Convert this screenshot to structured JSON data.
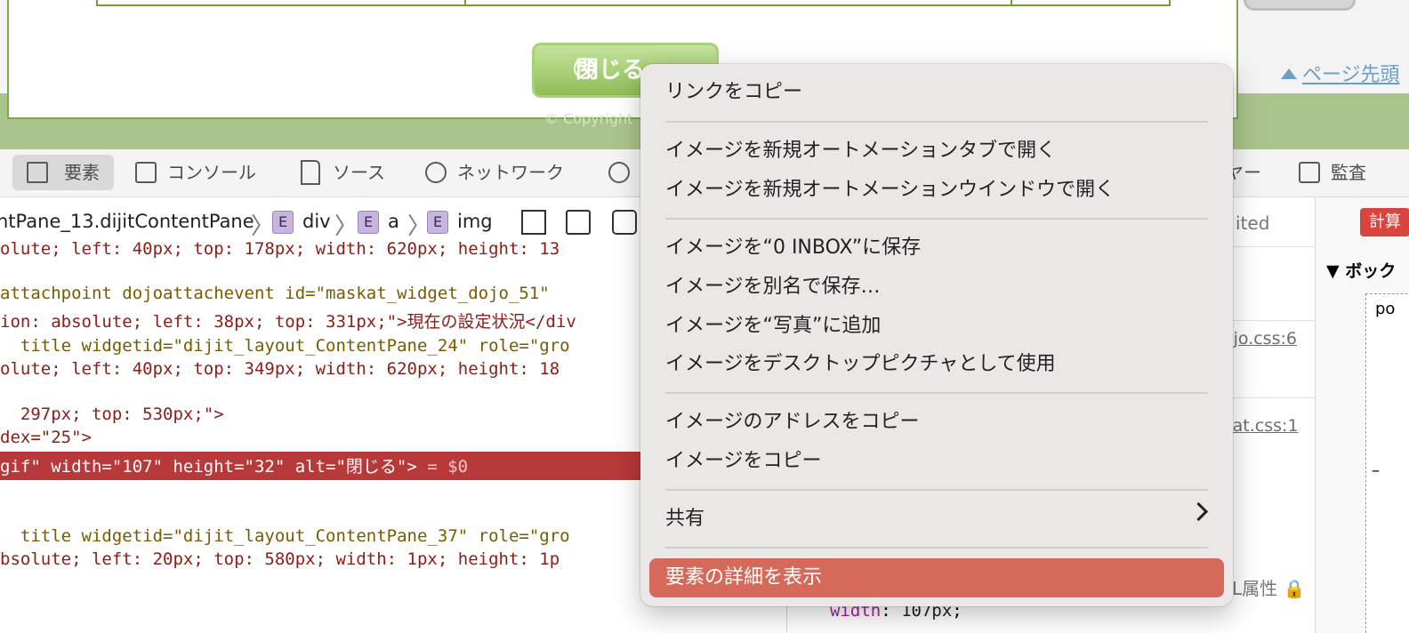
{
  "webpage": {
    "close_button": {
      "icon": "circle-x-icon",
      "label": "閉じる"
    },
    "page_top_link": "ページ先頭",
    "copyright": "© Copyright"
  },
  "devtools": {
    "tabs": [
      {
        "label": "要素",
        "icon": "elements-icon"
      },
      {
        "label": "コンソール",
        "icon": "console-icon"
      },
      {
        "label": "ソース",
        "icon": "sources-icon"
      },
      {
        "label": "ネットワーク",
        "icon": "network-icon"
      },
      {
        "label": "",
        "icon": "timeline-icon"
      },
      {
        "label": "ヤー",
        "icon": ""
      },
      {
        "label": "監査",
        "icon": "audit-icon"
      }
    ],
    "breadcrumb": [
      {
        "label": "ntPane_13.dijitContentPane",
        "badge": ""
      },
      {
        "label": "div",
        "badge": "E"
      },
      {
        "label": "a",
        "badge": "E"
      },
      {
        "label": "img",
        "badge": "E"
      }
    ],
    "code_lines": [
      "olute; left: 40px; top: 178px; width: 620px; height: 13",
      "attachpoint dojoattachevent id=\"maskat_widget_dojo_51\"",
      "ion: absolute; left: 38px; top: 331px;\">現在の設定状況</div",
      "  title widgetid=\"dijit_layout_ContentPane_24\" role=\"gro",
      "olute; left: 40px; top: 349px; width: 620px; height: 18",
      "  297px; top: 530px;\">",
      "dex=\"25\">",
      "gif\" width=\"107\" height=\"32\" alt=\"閉じる\">",
      "  title widgetid=\"dijit_layout_ContentPane_37\" role=\"gro",
      "bsolute; left: 20px; top: 580px; width: 1px; height: 1p"
    ],
    "selected_suffix": " = $0",
    "styles": {
      "header": "ited",
      "source_1": "ojo.css:6",
      "source_2": "kat.css:1",
      "attr_label": "L属性",
      "property_name": "width",
      "property_value": "107px"
    },
    "computed": {
      "badge": "計算",
      "section": "ボック",
      "box_label": "po",
      "dash": "–"
    }
  },
  "context_menu": {
    "items": [
      "リンクをコピー",
      "イメージを新規オートメーションタブで開く",
      "イメージを新規オートメーションウインドウで開く",
      "イメージを“0 INBOX”に保存",
      "イメージを別名で保存…",
      "イメージを“写真”に追加",
      "イメージをデスクトップピクチャとして使用",
      "イメージのアドレスをコピー",
      "イメージをコピー",
      "共有",
      "要素の詳細を表示"
    ],
    "highlighted": "要素の詳細を表示"
  },
  "colors": {
    "accent_green": "#8fbd57",
    "selection_red": "#b8393a",
    "menu_highlight": "#d56a5a"
  }
}
